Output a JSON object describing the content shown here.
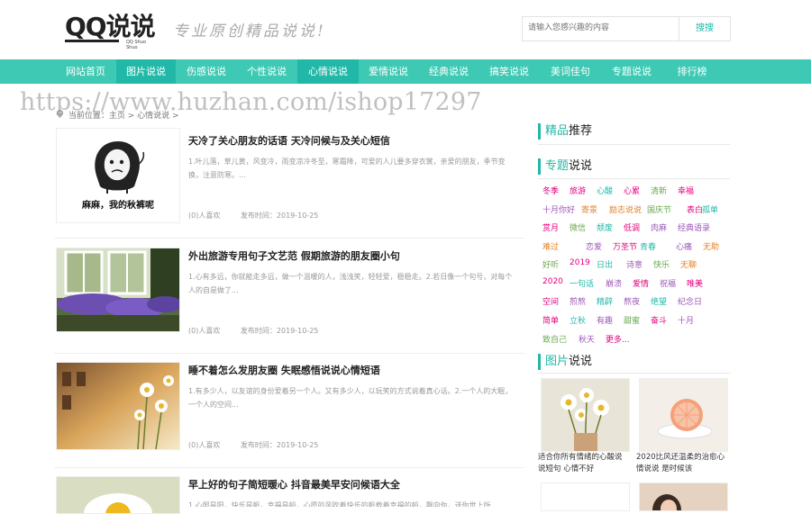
{
  "header": {
    "logo_text": "QQ说说",
    "logo_sub": "QQ Shuo Shuo",
    "slogan": "专业原创精品说说!",
    "search_placeholder": "请输入您感兴趣的内容",
    "search_button": "搜搜"
  },
  "nav": {
    "items": [
      {
        "label": "网站首页"
      },
      {
        "label": "图片说说"
      },
      {
        "label": "伤感说说"
      },
      {
        "label": "个性说说"
      },
      {
        "label": "心情说说"
      },
      {
        "label": "爱情说说"
      },
      {
        "label": "经典说说"
      },
      {
        "label": "搞笑说说"
      },
      {
        "label": "美词佳句"
      },
      {
        "label": "专题说说"
      },
      {
        "label": "排行榜"
      }
    ],
    "active_color": "#22b8a7",
    "bar_color": "#3dc9b3"
  },
  "watermark": "https://www.huzhan.com/ishop17297",
  "breadcrumb": "当前位置：主页 > 心情说说 >",
  "articles": [
    {
      "title": "天冷了关心朋友的话语 天冷问候与及关心短信",
      "excerpt": "1.叶儿落，草儿黄，风变冷，雨变凉冷冬至，寒霜降，可爱的人儿要多穿衣裳，亲爱的朋友，季节变换，注意防寒。...",
      "likes": "(0)人喜欢",
      "date": "发布时间：2019-10-25",
      "thumb_caption": "麻麻，我的秋裤呢"
    },
    {
      "title": "外出旅游专用句子文艺范 假期旅游的朋友圈小句",
      "excerpt": "1.心有多远，你就能走多远，做一个温暖的人，浅浅笑，轻轻爱，稳稳走。2.若日像一个句号，对每个人的自是做了...",
      "likes": "(0)人喜欢",
      "date": "发布时间：2019-10-25"
    },
    {
      "title": "睡不着怎么发朋友圈 失眠感悟说说心情短语",
      "excerpt": "1.有多少人，以友谊的身份爱着另一个人。又有多少人，以玩笑的方式说着真心话。2.一个人的大眠，一个人的空间...",
      "likes": "(0)人喜欢",
      "date": "发布时间：2019-10-25"
    },
    {
      "title": "早上好的句子简短暖心 抖音最美早安问候语大全",
      "excerpt": "1.心照是阳，快乐是帆，幸福是船，心愿的风吹着快乐的帆载着幸福的船，飘向你，送你世上所"
    }
  ],
  "sidebar": {
    "recommend_title_hl": "精品",
    "recommend_title": "推荐",
    "topic_title_hl": "专题",
    "topic_title": "说说",
    "tags": [
      {
        "label": "冬季",
        "color": "#e4007f"
      },
      {
        "label": "旅游",
        "color": "#e4007f"
      },
      {
        "label": "心酸",
        "color": "#22b8a7"
      },
      {
        "label": "心累",
        "color": "#e4007f"
      },
      {
        "label": "清新",
        "color": "#6aa84f"
      },
      {
        "label": "幸福",
        "color": "#e4007f"
      },
      {
        "label": "十月你好",
        "color": "#9b59b6"
      },
      {
        "label": "寄景",
        "color": "#e67e22"
      },
      {
        "label": "励志说说",
        "color": "#e67e22"
      },
      {
        "label": "国庆节",
        "color": "#6aa84f"
      },
      {
        "label": "表白",
        "color": "#e4007f"
      },
      {
        "label": "孤单",
        "color": "#22b8a7"
      },
      {
        "label": "赏月",
        "color": "#e4007f"
      },
      {
        "label": "微信",
        "color": "#6aa84f"
      },
      {
        "label": "颓废",
        "color": "#22b8a7"
      },
      {
        "label": "低调",
        "color": "#e4007f"
      },
      {
        "label": "肉麻",
        "color": "#9b59b6"
      },
      {
        "label": "经典语录",
        "color": "#9b59b6"
      },
      {
        "label": "难过",
        "color": "#e67e22"
      },
      {
        "label": "恋爱",
        "color": "#9b59b6"
      },
      {
        "label": "万圣节",
        "color": "#e4007f"
      },
      {
        "label": "青春",
        "color": "#22b8a7"
      },
      {
        "label": "心痛",
        "color": "#9b59b6"
      },
      {
        "label": "无助",
        "color": "#e67e22"
      },
      {
        "label": "好听",
        "color": "#6aa84f"
      },
      {
        "label": "2019",
        "color": "#e4007f"
      },
      {
        "label": "日出",
        "color": "#22b8a7"
      },
      {
        "label": "诗意",
        "color": "#9b59b6"
      },
      {
        "label": "快乐",
        "color": "#6aa84f"
      },
      {
        "label": "无聊",
        "color": "#e67e22"
      },
      {
        "label": "2020",
        "color": "#e4007f"
      },
      {
        "label": "一句话",
        "color": "#22b8a7"
      },
      {
        "label": "崩溃",
        "color": "#9b59b6"
      },
      {
        "label": "爱情",
        "color": "#e4007f"
      },
      {
        "label": "祝福",
        "color": "#9b59b6"
      },
      {
        "label": "唯美",
        "color": "#e4007f"
      },
      {
        "label": "空间",
        "color": "#e4007f"
      },
      {
        "label": "煎熬",
        "color": "#9b59b6"
      },
      {
        "label": "精辟",
        "color": "#22b8a7"
      },
      {
        "label": "熬夜",
        "color": "#9b59b6"
      },
      {
        "label": "绝望",
        "color": "#22b8a7"
      },
      {
        "label": "纪念日",
        "color": "#9b59b6"
      },
      {
        "label": "简单",
        "color": "#e4007f"
      },
      {
        "label": "立秋",
        "color": "#22b8a7"
      },
      {
        "label": "有趣",
        "color": "#9b59b6"
      },
      {
        "label": "甜蜜",
        "color": "#6aa84f"
      },
      {
        "label": "奋斗",
        "color": "#e4007f"
      },
      {
        "label": "十月",
        "color": "#9b59b6"
      },
      {
        "label": "致自己",
        "color": "#6aa84f"
      },
      {
        "label": "秋天",
        "color": "#9b59b6"
      },
      {
        "label": "更多...",
        "color": "#e4007f"
      }
    ],
    "pic_title_hl": "图片",
    "pic_title": "说说",
    "pics": [
      {
        "caption": "适合你所有情绪的心酸说说短句 心情不好"
      },
      {
        "caption": "2020比风还温柔的治愈心情说说 是时候该"
      }
    ]
  }
}
